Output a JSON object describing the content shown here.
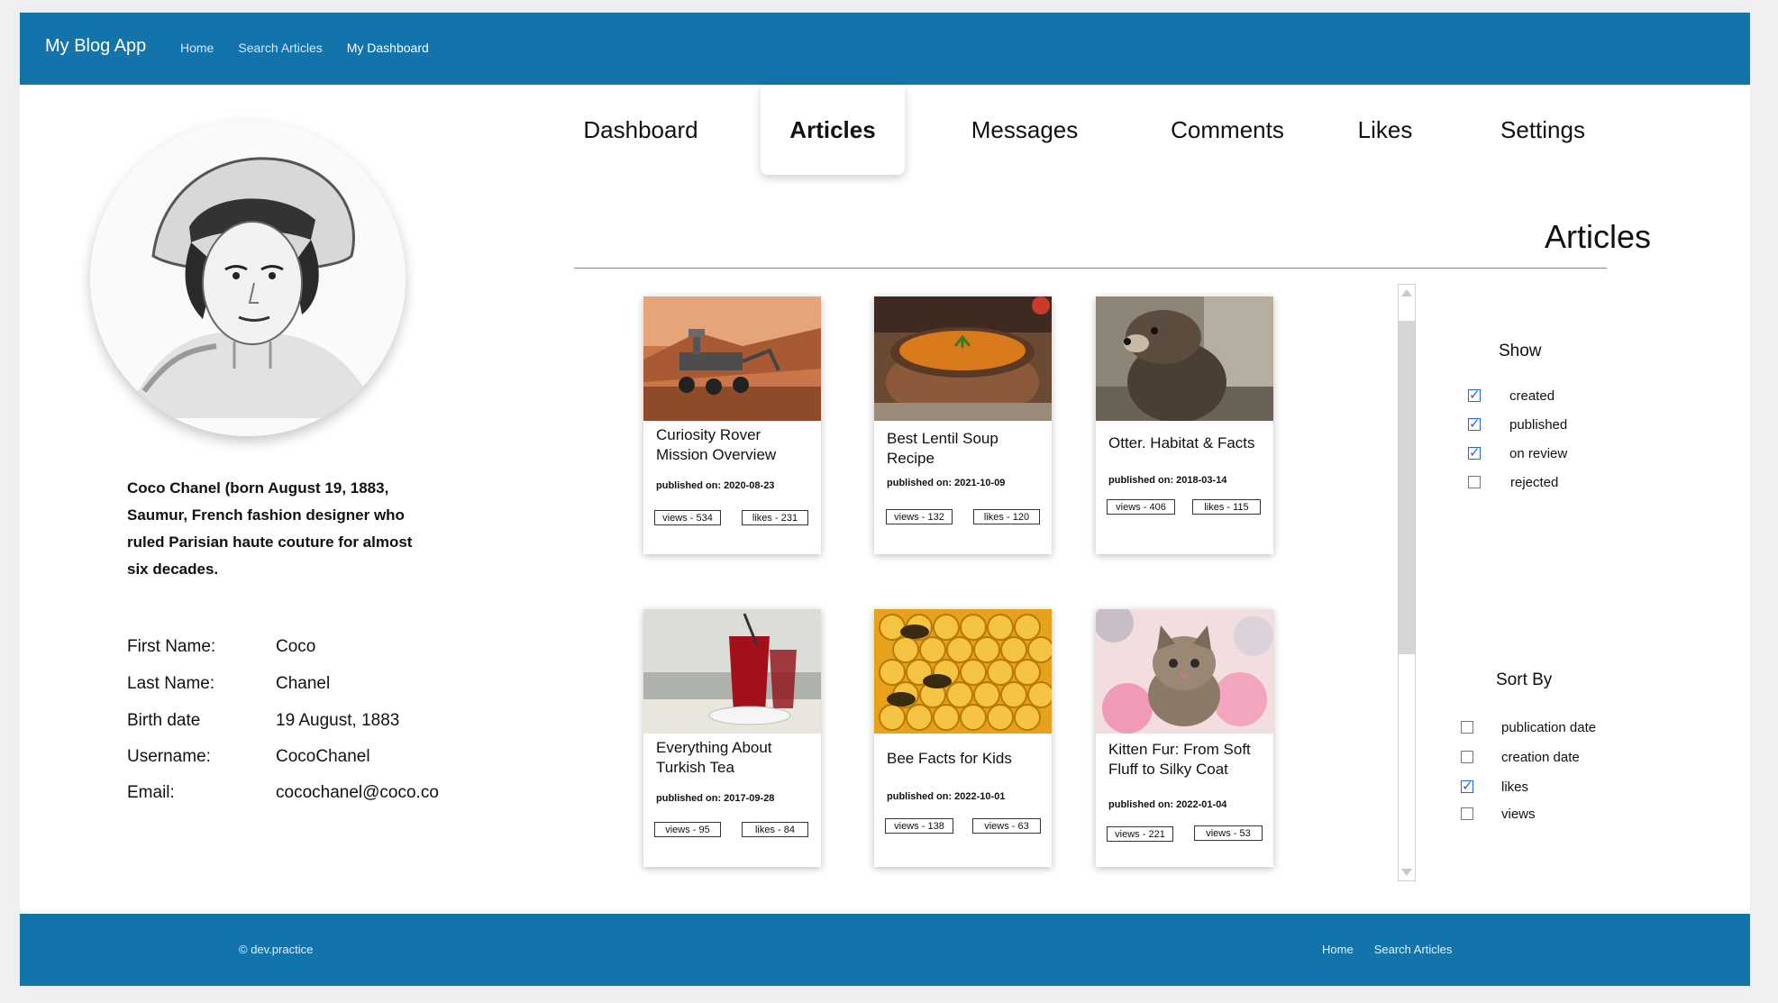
{
  "header": {
    "brand": "My Blog App",
    "nav": [
      "Home",
      "Search Articles",
      "My Dashboard"
    ]
  },
  "profile": {
    "bio": "Coco Chanel (born August 19, 1883, Saumur,  French fashion designer who ruled Parisian haute couture for almost six decades.",
    "fields": [
      {
        "label": "First Name:",
        "value": "Coco"
      },
      {
        "label": "Last Name:",
        "value": "Chanel"
      },
      {
        "label": "Birth date",
        "value": "19 August, 1883"
      },
      {
        "label": "Username:",
        "value": "CocoChanel"
      },
      {
        "label": "Email:",
        "value": "cocochanel@coco.co"
      }
    ]
  },
  "tabs": [
    "Dashboard",
    "Articles",
    "Messages",
    "Comments",
    "Likes",
    "Settings"
  ],
  "active_tab": "Articles",
  "section_title": "Articles",
  "articles": [
    {
      "title": "Curiosity Rover Mission Overview",
      "published": "published on:  2020-08-23",
      "chip1": "views - 534",
      "chip2": "likes - 231",
      "image": "mars-rover-image"
    },
    {
      "title": "Best Lentil Soup Recipe",
      "published": "published on:  2021-10-09",
      "chip1": "views - 132",
      "chip2": "likes - 120",
      "image": "lentil-soup-image"
    },
    {
      "title": "Otter. Habitat & Facts",
      "published": "published on:  2018-03-14",
      "chip1": "views - 406",
      "chip2": "likes - 115",
      "image": "otter-image"
    },
    {
      "title": "Everything About Turkish Tea",
      "published": "published on:  2017-09-28",
      "chip1": "views - 95",
      "chip2": "likes - 84",
      "image": "turkish-tea-image"
    },
    {
      "title": "Bee Facts for Kids",
      "published": "published on:  2022-10-01",
      "chip1": "views - 138",
      "chip2": "views - 63",
      "image": "bees-honeycomb-image"
    },
    {
      "title": "Kitten Fur: From Soft Fluff to Silky Coat",
      "published": "published on:  2022-01-04",
      "chip1": "views - 221",
      "chip2": "views - 53",
      "image": "kitten-image"
    }
  ],
  "filters": {
    "show": {
      "title": "Show",
      "options": [
        {
          "label": "created",
          "checked": true
        },
        {
          "label": "published",
          "checked": true
        },
        {
          "label": "on review",
          "checked": true
        },
        {
          "label": "rejected",
          "checked": false
        }
      ]
    },
    "sort": {
      "title": "Sort By",
      "options": [
        {
          "label": "publication date",
          "checked": false
        },
        {
          "label": "creation date",
          "checked": false
        },
        {
          "label": "likes",
          "checked": true
        },
        {
          "label": "views",
          "checked": false
        }
      ]
    }
  },
  "footer": {
    "copyright": "© dev.practice",
    "nav": [
      "Home",
      "Search Articles"
    ]
  },
  "colors": {
    "brand_blue": "#1274ab",
    "checkbox_blue": "#1f66d9"
  }
}
